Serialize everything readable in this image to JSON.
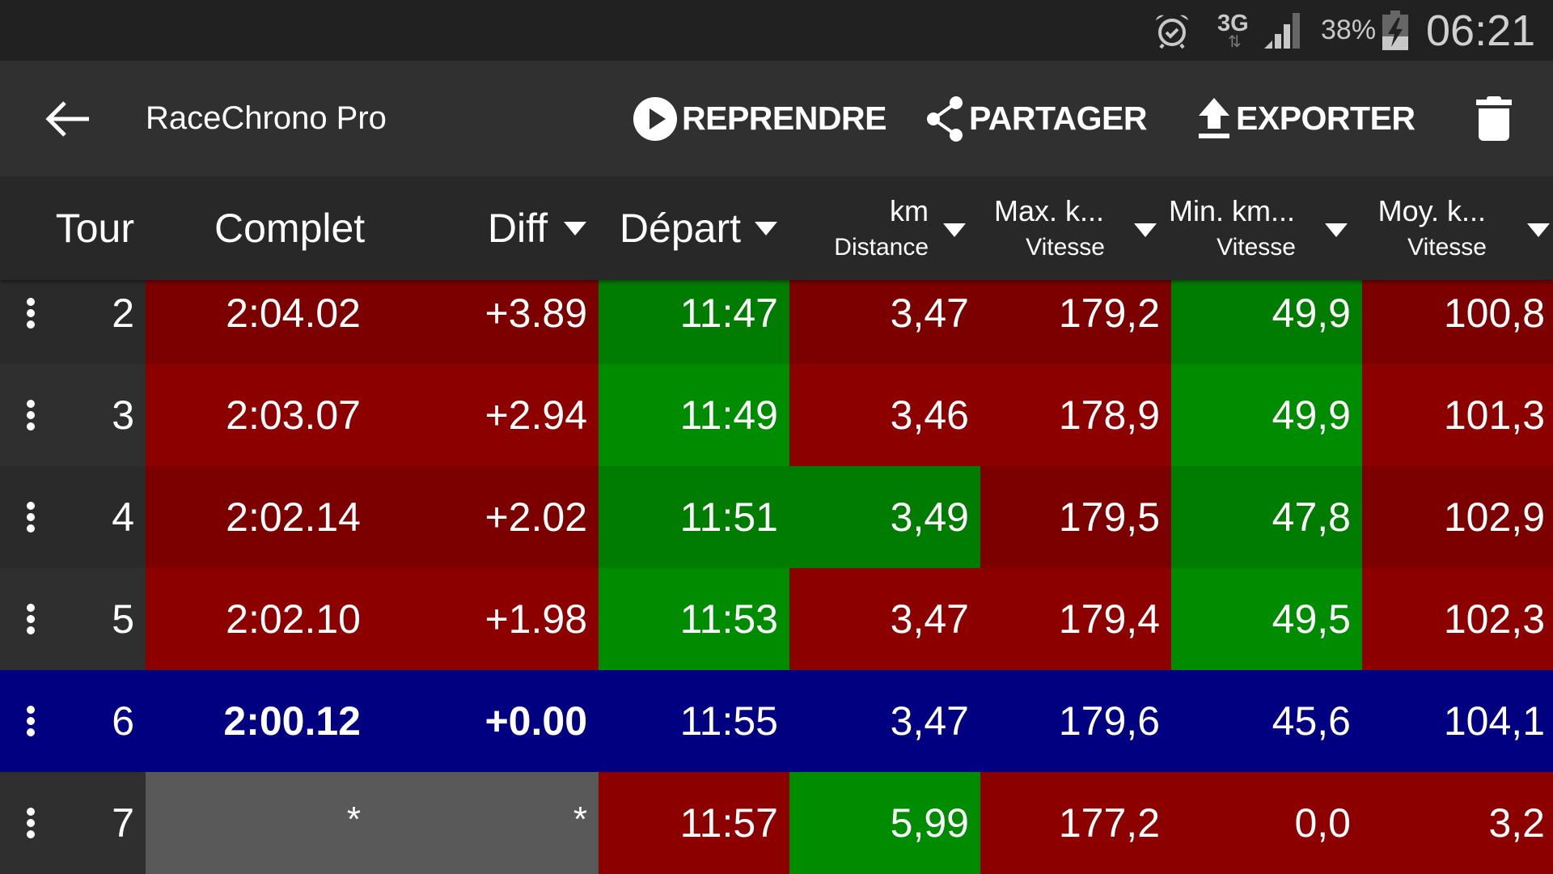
{
  "status_bar": {
    "network": "3G",
    "battery_percent": "38%",
    "time": "06:21",
    "icons": [
      "alarm-icon",
      "network-3g-icon",
      "signal-icon",
      "battery-charging-icon"
    ]
  },
  "toolbar": {
    "back_icon": "arrow-left-icon",
    "title": "RaceChrono Pro",
    "resume_label": "REPRENDRE",
    "share_label": "PARTAGER",
    "export_label": "EXPORTER",
    "delete_icon": "trash-icon"
  },
  "table": {
    "columns": {
      "lap": {
        "label": "Tour"
      },
      "complet": {
        "label": "Complet"
      },
      "diff": {
        "label": "Diff"
      },
      "depart": {
        "label": "Départ"
      },
      "distance": {
        "label": "km",
        "sub": "Distance"
      },
      "max": {
        "label": "Max. k...",
        "sub": "Vitesse"
      },
      "min": {
        "label": "Min. km...",
        "sub": "Vitesse"
      },
      "moy": {
        "label": "Moy. k...",
        "sub": "Vitesse"
      }
    },
    "colors": {
      "red_dark": "#7c0000",
      "red_light": "#8c0000",
      "green_dark": "#007c00",
      "green_light": "#008c00",
      "best_lap_blue": "#000080",
      "incomplete_gray": "#595959",
      "lap_col_dark": "#2a2a2a",
      "lap_col_light": "#2f2f2f"
    },
    "rows": [
      {
        "lap": "2",
        "complet": "2:04.02",
        "diff": "+3.89",
        "depart": "11:47",
        "distance": "3,47",
        "max": "179,2",
        "min": "49,9",
        "moy": "100,8",
        "state": {
          "time": "red",
          "depart": "green",
          "distance": "red",
          "max": "red",
          "min": "green",
          "moy": "red"
        }
      },
      {
        "lap": "3",
        "complet": "2:03.07",
        "diff": "+2.94",
        "depart": "11:49",
        "distance": "3,46",
        "max": "178,9",
        "min": "49,9",
        "moy": "101,3",
        "state": {
          "time": "red",
          "depart": "green",
          "distance": "red",
          "max": "red",
          "min": "green",
          "moy": "red"
        }
      },
      {
        "lap": "4",
        "complet": "2:02.14",
        "diff": "+2.02",
        "depart": "11:51",
        "distance": "3,49",
        "max": "179,5",
        "min": "47,8",
        "moy": "102,9",
        "state": {
          "time": "red",
          "depart": "green",
          "distance": "green",
          "max": "red",
          "min": "green",
          "moy": "red"
        }
      },
      {
        "lap": "5",
        "complet": "2:02.10",
        "diff": "+1.98",
        "depart": "11:53",
        "distance": "3,47",
        "max": "179,4",
        "min": "49,5",
        "moy": "102,3",
        "state": {
          "time": "red",
          "depart": "green",
          "distance": "red",
          "max": "red",
          "min": "green",
          "moy": "red"
        }
      },
      {
        "lap": "6",
        "complet": "2:00.12",
        "diff": "+0.00",
        "depart": "11:55",
        "distance": "3,47",
        "max": "179,6",
        "min": "45,6",
        "moy": "104,1",
        "best": true,
        "state": {
          "time": "blue",
          "depart": "blue",
          "distance": "blue",
          "max": "blue",
          "min": "blue",
          "moy": "blue"
        }
      },
      {
        "lap": "7",
        "complet": "*",
        "diff": "*",
        "depart": "11:57",
        "distance": "5,99",
        "max": "177,2",
        "min": "0,0",
        "moy": "3,2",
        "state": {
          "time": "gray",
          "depart": "red",
          "distance": "green",
          "max": "red",
          "min": "red",
          "moy": "red"
        }
      }
    ]
  }
}
